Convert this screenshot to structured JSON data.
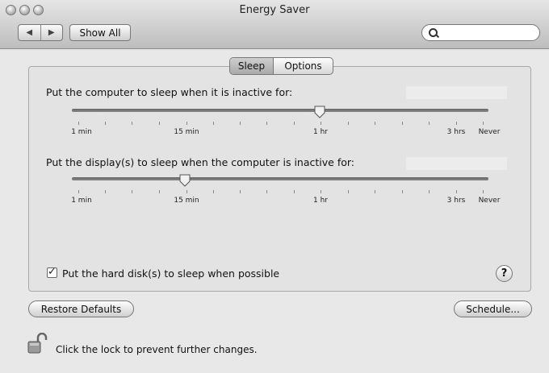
{
  "window": {
    "title": "Energy Saver"
  },
  "toolbar": {
    "back_icon": "◀",
    "forward_icon": "▶",
    "show_all_label": "Show All",
    "search_placeholder": "",
    "search_value": ""
  },
  "tabs": [
    {
      "label": "Sleep",
      "selected": true
    },
    {
      "label": "Options",
      "selected": false
    }
  ],
  "computer_sleep": {
    "label": "Put the computer to sleep when it is inactive for:",
    "value": "1 hr",
    "tick_labels": [
      "1 min",
      "15 min",
      "1 hr",
      "3 hrs",
      "Never"
    ]
  },
  "display_sleep": {
    "label": "Put the display(s) to sleep when the computer is inactive for:",
    "value": "15 min",
    "tick_labels": [
      "1 min",
      "15 min",
      "1 hr",
      "3 hrs",
      "Never"
    ]
  },
  "hard_disk": {
    "label": "Put the hard disk(s) to sleep when possible",
    "checked": true
  },
  "help": {
    "label": "?"
  },
  "buttons": {
    "restore_defaults": "Restore Defaults",
    "schedule": "Schedule..."
  },
  "lock": {
    "text": "Click the lock to prevent further changes.",
    "state": "unlocked"
  }
}
